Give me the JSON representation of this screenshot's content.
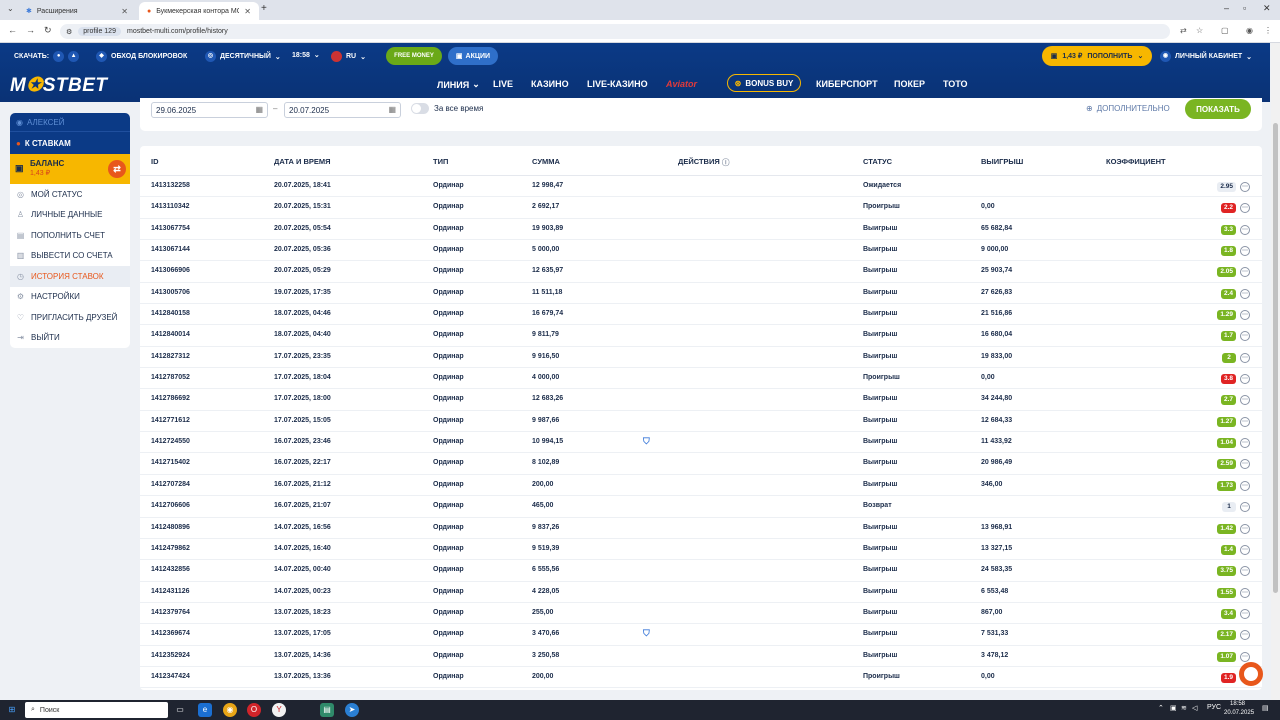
{
  "browser": {
    "tabs": [
      {
        "label": "Расширения",
        "active": false
      },
      {
        "label": "Букмекерская контора MOSTBET",
        "active": true
      }
    ],
    "new_tab": "+",
    "profile_chip": "profile 129",
    "url": "mostbet-multi.com/profile/history"
  },
  "header": {
    "download_label": "СКАЧАТЬ:",
    "bypass_label": "ОБХОД БЛОКИРОВОК",
    "odds_format": "ДЕСЯТИЧНЫЙ",
    "time": "18:58",
    "lang": "RU",
    "free_money": "FREE MONEY",
    "promos": "АКЦИИ",
    "balance": "1,43 ₽",
    "deposit_label": "ПОПОЛНИТЬ",
    "cabinet_label": "ЛИЧНЫЙ КАБИНЕТ",
    "logo": "MOSTBET",
    "nav": {
      "line": "ЛИНИЯ",
      "live": "LIVE",
      "casino": "КАЗИНО",
      "live_casino": "LIVE-КАЗИНО",
      "aviator": "Aviator",
      "bonus_buy": "BONUS BUY",
      "esports": "КИБЕРСПОРТ",
      "poker": "ПОКЕР",
      "toto": "ТОТО"
    }
  },
  "sidebar": {
    "user": "АЛЕКСЕЙ",
    "to_bets": "К СТАВКАМ",
    "balance_label": "БАЛАНС",
    "balance_value": "1,43 ₽",
    "items": {
      "status": "МОЙ СТАТУС",
      "personal": "ЛИЧНЫЕ ДАННЫЕ",
      "deposit": "ПОПОЛНИТЬ СЧЕТ",
      "withdraw": "ВЫВЕСТИ СО СЧЕТА",
      "history": "ИСТОРИЯ СТАВОК",
      "settings": "НАСТРОЙКИ",
      "invite": "ПРИГЛАСИТЬ ДРУЗЕЙ",
      "logout": "ВЫЙТИ"
    }
  },
  "filter": {
    "date_from": "29.06.2025",
    "dash": "–",
    "date_to": "20.07.2025",
    "all_time": "За все время",
    "extra": "ДОПОЛНИТЕЛЬНО",
    "show": "ПОКАЗАТЬ"
  },
  "table": {
    "headers": {
      "id": "ID",
      "date": "ДАТА И ВРЕМЯ",
      "type": "ТИП",
      "amount": "СУММА",
      "actions": "ДЕЙСТВИЯ",
      "status": "СТАТУС",
      "win": "ВЫИГРЫШ",
      "coef": "КОЭФФИЦИЕНТ"
    },
    "rows": [
      {
        "id": "1413132258",
        "date": "20.07.2025, 18:41",
        "type": "Ординар",
        "amount": "12 998,47",
        "status": "Ожидается",
        "win": "",
        "coef": "2.95",
        "color": "white",
        "shield": false
      },
      {
        "id": "1413110342",
        "date": "20.07.2025, 15:31",
        "type": "Ординар",
        "amount": "2 692,17",
        "status": "Проигрыш",
        "win": "0,00",
        "coef": "2.2",
        "color": "red",
        "shield": false
      },
      {
        "id": "1413067754",
        "date": "20.07.2025, 05:54",
        "type": "Ординар",
        "amount": "19 903,89",
        "status": "Выигрыш",
        "win": "65 682,84",
        "coef": "3.3",
        "color": "green",
        "shield": false
      },
      {
        "id": "1413067144",
        "date": "20.07.2025, 05:36",
        "type": "Ординар",
        "amount": "5 000,00",
        "status": "Выигрыш",
        "win": "9 000,00",
        "coef": "1.8",
        "color": "green",
        "shield": false
      },
      {
        "id": "1413066906",
        "date": "20.07.2025, 05:29",
        "type": "Ординар",
        "amount": "12 635,97",
        "status": "Выигрыш",
        "win": "25 903,74",
        "coef": "2.05",
        "color": "green",
        "shield": false
      },
      {
        "id": "1413005706",
        "date": "19.07.2025, 17:35",
        "type": "Ординар",
        "amount": "11 511,18",
        "status": "Выигрыш",
        "win": "27 626,83",
        "coef": "2.4",
        "color": "green",
        "shield": false
      },
      {
        "id": "1412840158",
        "date": "18.07.2025, 04:46",
        "type": "Ординар",
        "amount": "16 679,74",
        "status": "Выигрыш",
        "win": "21 516,86",
        "coef": "1.29",
        "color": "green",
        "shield": false
      },
      {
        "id": "1412840014",
        "date": "18.07.2025, 04:40",
        "type": "Ординар",
        "amount": "9 811,79",
        "status": "Выигрыш",
        "win": "16 680,04",
        "coef": "1.7",
        "color": "green",
        "shield": false
      },
      {
        "id": "1412827312",
        "date": "17.07.2025, 23:35",
        "type": "Ординар",
        "amount": "9 916,50",
        "status": "Выигрыш",
        "win": "19 833,00",
        "coef": "2",
        "color": "green",
        "shield": false
      },
      {
        "id": "1412787052",
        "date": "17.07.2025, 18:04",
        "type": "Ординар",
        "amount": "4 000,00",
        "status": "Проигрыш",
        "win": "0,00",
        "coef": "3.8",
        "color": "red",
        "shield": false
      },
      {
        "id": "1412786692",
        "date": "17.07.2025, 18:00",
        "type": "Ординар",
        "amount": "12 683,26",
        "status": "Выигрыш",
        "win": "34 244,80",
        "coef": "2.7",
        "color": "green",
        "shield": false
      },
      {
        "id": "1412771612",
        "date": "17.07.2025, 15:05",
        "type": "Ординар",
        "amount": "9 987,66",
        "status": "Выигрыш",
        "win": "12 684,33",
        "coef": "1.27",
        "color": "green",
        "shield": false
      },
      {
        "id": "1412724550",
        "date": "16.07.2025, 23:46",
        "type": "Ординар",
        "amount": "10 994,15",
        "status": "Выигрыш",
        "win": "11 433,92",
        "coef": "1.04",
        "color": "green",
        "shield": true
      },
      {
        "id": "1412715402",
        "date": "16.07.2025, 22:17",
        "type": "Ординар",
        "amount": "8 102,89",
        "status": "Выигрыш",
        "win": "20 986,49",
        "coef": "2.59",
        "color": "green",
        "shield": false
      },
      {
        "id": "1412707284",
        "date": "16.07.2025, 21:12",
        "type": "Ординар",
        "amount": "200,00",
        "status": "Выигрыш",
        "win": "346,00",
        "coef": "1.73",
        "color": "green",
        "shield": false
      },
      {
        "id": "1412706606",
        "date": "16.07.2025, 21:07",
        "type": "Ординар",
        "amount": "465,00",
        "status": "Возврат",
        "win": "",
        "coef": "1",
        "color": "white",
        "shield": false
      },
      {
        "id": "1412480896",
        "date": "14.07.2025, 16:56",
        "type": "Ординар",
        "amount": "9 837,26",
        "status": "Выигрыш",
        "win": "13 968,91",
        "coef": "1.42",
        "color": "green",
        "shield": false
      },
      {
        "id": "1412479862",
        "date": "14.07.2025, 16:40",
        "type": "Ординар",
        "amount": "9 519,39",
        "status": "Выигрыш",
        "win": "13 327,15",
        "coef": "1.4",
        "color": "green",
        "shield": false
      },
      {
        "id": "1412432856",
        "date": "14.07.2025, 00:40",
        "type": "Ординар",
        "amount": "6 555,56",
        "status": "Выигрыш",
        "win": "24 583,35",
        "coef": "3.75",
        "color": "green",
        "shield": false
      },
      {
        "id": "1412431126",
        "date": "14.07.2025, 00:23",
        "type": "Ординар",
        "amount": "4 228,05",
        "status": "Выигрыш",
        "win": "6 553,48",
        "coef": "1.55",
        "color": "green",
        "shield": false
      },
      {
        "id": "1412379764",
        "date": "13.07.2025, 18:23",
        "type": "Ординар",
        "amount": "255,00",
        "status": "Выигрыш",
        "win": "867,00",
        "coef": "3.4",
        "color": "green",
        "shield": false
      },
      {
        "id": "1412369674",
        "date": "13.07.2025, 17:05",
        "type": "Ординар",
        "amount": "3 470,66",
        "status": "Выигрыш",
        "win": "7 531,33",
        "coef": "2.17",
        "color": "green",
        "shield": true
      },
      {
        "id": "1412352924",
        "date": "13.07.2025, 14:36",
        "type": "Ординар",
        "amount": "3 250,58",
        "status": "Выигрыш",
        "win": "3 478,12",
        "coef": "1.07",
        "color": "green",
        "shield": false
      },
      {
        "id": "1412347424",
        "date": "13.07.2025, 13:36",
        "type": "Ординар",
        "amount": "200,00",
        "status": "Проигрыш",
        "win": "0,00",
        "coef": "1.9",
        "color": "red",
        "shield": false
      }
    ]
  },
  "taskbar": {
    "search": "Поиск",
    "lang": "РУС",
    "time": "18:58",
    "date": "20.07.2025"
  },
  "colors": {
    "header_bg": "#0b3a86",
    "accent_yellow": "#f7b700",
    "accent_orange": "#e8571b",
    "win_green": "#7ab522",
    "loss_red": "#e02424"
  }
}
